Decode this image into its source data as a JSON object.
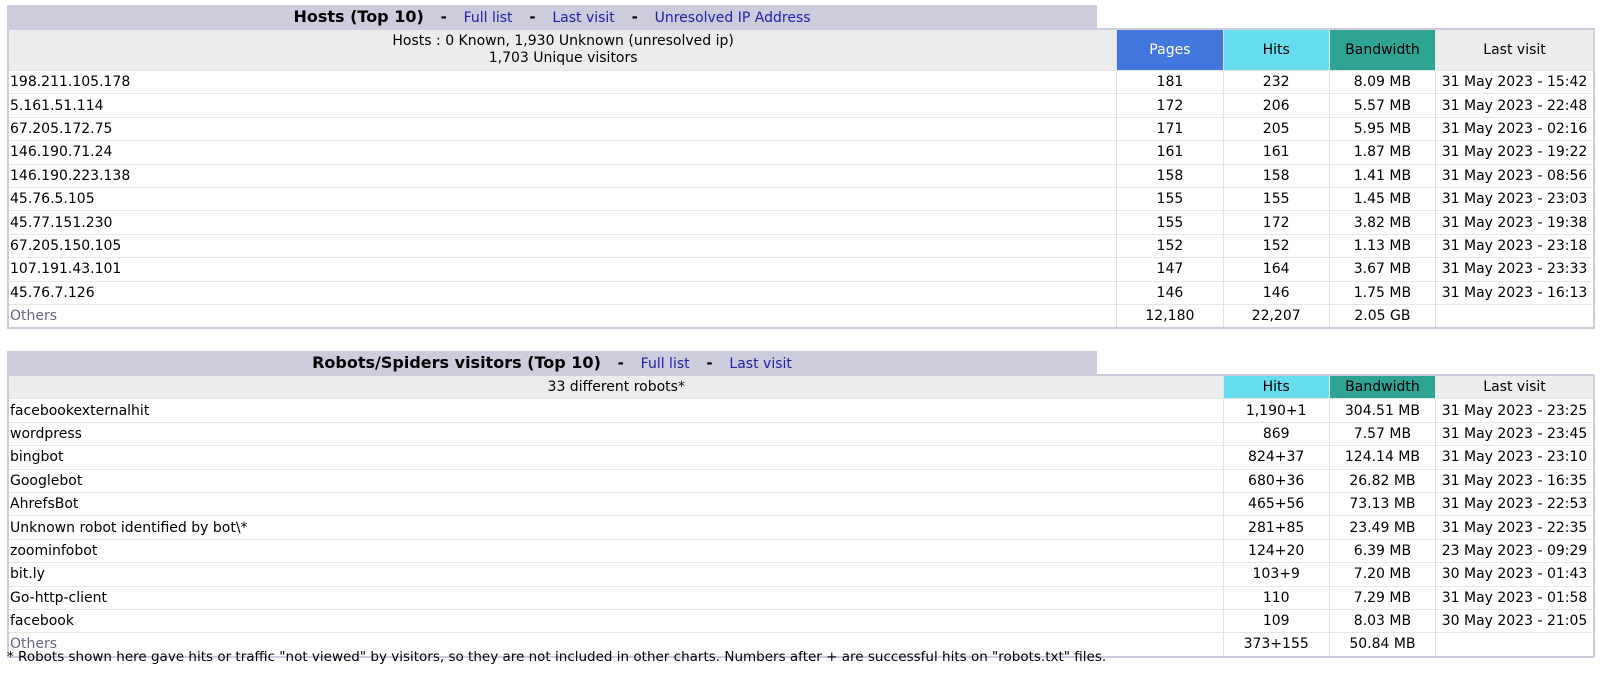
{
  "colors": {
    "title_bar": "#ccccdd",
    "pages_header": "#4477dd",
    "hits_header": "#66ddee",
    "bandwidth_header": "#2ea495",
    "link": "#2020aa"
  },
  "hosts": {
    "title": "Hosts (Top 10)",
    "sep": "-",
    "links": [
      "Full list",
      "Last visit",
      "Unresolved IP Address"
    ],
    "info_line1": "Hosts : 0 Known, 1,930 Unknown (unresolved ip)",
    "info_line2": "1,703 Unique visitors",
    "headers": {
      "pages": "Pages",
      "hits": "Hits",
      "bandwidth": "Bandwidth",
      "last_visit": "Last visit"
    },
    "rows": [
      {
        "host": "198.211.105.178",
        "pages": "181",
        "hits": "232",
        "bandwidth": "8.09 MB",
        "last_visit": "31 May 2023 - 15:42"
      },
      {
        "host": "5.161.51.114",
        "pages": "172",
        "hits": "206",
        "bandwidth": "5.57 MB",
        "last_visit": "31 May 2023 - 22:48"
      },
      {
        "host": "67.205.172.75",
        "pages": "171",
        "hits": "205",
        "bandwidth": "5.95 MB",
        "last_visit": "31 May 2023 - 02:16"
      },
      {
        "host": "146.190.71.24",
        "pages": "161",
        "hits": "161",
        "bandwidth": "1.87 MB",
        "last_visit": "31 May 2023 - 19:22"
      },
      {
        "host": "146.190.223.138",
        "pages": "158",
        "hits": "158",
        "bandwidth": "1.41 MB",
        "last_visit": "31 May 2023 - 08:56"
      },
      {
        "host": "45.76.5.105",
        "pages": "155",
        "hits": "155",
        "bandwidth": "1.45 MB",
        "last_visit": "31 May 2023 - 23:03"
      },
      {
        "host": "45.77.151.230",
        "pages": "155",
        "hits": "172",
        "bandwidth": "3.82 MB",
        "last_visit": "31 May 2023 - 19:38"
      },
      {
        "host": "67.205.150.105",
        "pages": "152",
        "hits": "152",
        "bandwidth": "1.13 MB",
        "last_visit": "31 May 2023 - 23:18"
      },
      {
        "host": "107.191.43.101",
        "pages": "147",
        "hits": "164",
        "bandwidth": "3.67 MB",
        "last_visit": "31 May 2023 - 23:33"
      },
      {
        "host": "45.76.7.126",
        "pages": "146",
        "hits": "146",
        "bandwidth": "1.75 MB",
        "last_visit": "31 May 2023 - 16:13"
      }
    ],
    "others": {
      "label": "Others",
      "pages": "12,180",
      "hits": "22,207",
      "bandwidth": "2.05 GB",
      "last_visit": ""
    }
  },
  "robots": {
    "title": "Robots/Spiders visitors (Top 10)",
    "sep": "-",
    "links": [
      "Full list",
      "Last visit"
    ],
    "info": "33 different robots*",
    "headers": {
      "hits": "Hits",
      "bandwidth": "Bandwidth",
      "last_visit": "Last visit"
    },
    "rows": [
      {
        "name": "facebookexternalhit",
        "hits": "1,190+1",
        "bandwidth": "304.51 MB",
        "last_visit": "31 May 2023 - 23:25"
      },
      {
        "name": "wordpress",
        "hits": "869",
        "bandwidth": "7.57 MB",
        "last_visit": "31 May 2023 - 23:45"
      },
      {
        "name": "bingbot",
        "hits": "824+37",
        "bandwidth": "124.14 MB",
        "last_visit": "31 May 2023 - 23:10"
      },
      {
        "name": "Googlebot",
        "hits": "680+36",
        "bandwidth": "26.82 MB",
        "last_visit": "31 May 2023 - 16:35"
      },
      {
        "name": "AhrefsBot",
        "hits": "465+56",
        "bandwidth": "73.13 MB",
        "last_visit": "31 May 2023 - 22:53"
      },
      {
        "name": "Unknown robot identified by bot\\*",
        "hits": "281+85",
        "bandwidth": "23.49 MB",
        "last_visit": "31 May 2023 - 22:35"
      },
      {
        "name": "zoominfobot",
        "hits": "124+20",
        "bandwidth": "6.39 MB",
        "last_visit": "23 May 2023 - 09:29"
      },
      {
        "name": "bit.ly",
        "hits": "103+9",
        "bandwidth": "7.20 MB",
        "last_visit": "30 May 2023 - 01:43"
      },
      {
        "name": "Go-http-client",
        "hits": "110",
        "bandwidth": "7.29 MB",
        "last_visit": "31 May 2023 - 01:58"
      },
      {
        "name": "facebook",
        "hits": "109",
        "bandwidth": "8.03 MB",
        "last_visit": "30 May 2023 - 21:05"
      }
    ],
    "others": {
      "label": "Others",
      "hits": "373+155",
      "bandwidth": "50.84 MB",
      "last_visit": ""
    },
    "footnote": "* Robots shown here gave hits or traffic \"not viewed\" by visitors, so they are not included in other charts. Numbers after + are successful hits on \"robots.txt\" files."
  }
}
